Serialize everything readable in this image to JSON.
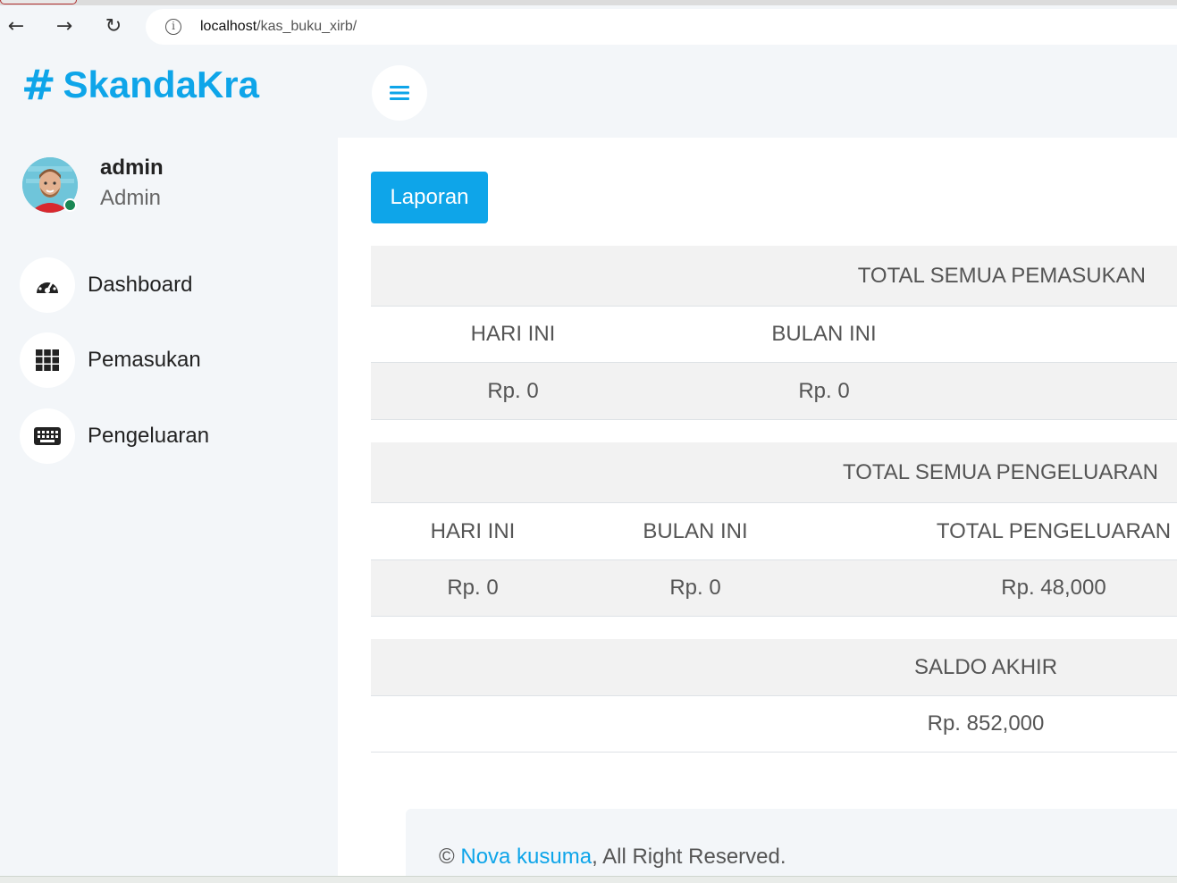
{
  "browser": {
    "back_icon": "←",
    "forward_icon": "→",
    "reload_icon": "↻",
    "info_icon": "i",
    "url_host": "localhost",
    "url_path": "/kas_buku_xirb/"
  },
  "brand": {
    "hash": "#",
    "name": "SkandaKra",
    "color": "#0ea5e9"
  },
  "profile": {
    "name": "admin",
    "role": "Admin",
    "status": "online"
  },
  "sidebar": {
    "items": [
      {
        "label": "Dashboard",
        "icon": "gauge-icon"
      },
      {
        "label": "Pemasukan",
        "icon": "grid-icon"
      },
      {
        "label": "Pengeluaran",
        "icon": "keyboard-icon"
      }
    ]
  },
  "content": {
    "laporan_button": "Laporan",
    "pemasukan": {
      "title": "TOTAL SEMUA PEMASUKAN",
      "headers": [
        "HARI INI",
        "BULAN INI"
      ],
      "values": [
        "Rp. 0",
        "Rp. 0"
      ]
    },
    "pengeluaran": {
      "title": "TOTAL SEMUA PENGELUARAN",
      "headers": [
        "HARI INI",
        "BULAN INI",
        "TOTAL PENGELUARAN"
      ],
      "values": [
        "Rp. 0",
        "Rp. 0",
        "Rp. 48,000"
      ]
    },
    "saldo": {
      "title": "SALDO AKHIR",
      "value": "Rp. 852,000"
    }
  },
  "footer": {
    "copyright": "©",
    "author": "Nova kusuma",
    "rights": ", All Right Reserved."
  }
}
